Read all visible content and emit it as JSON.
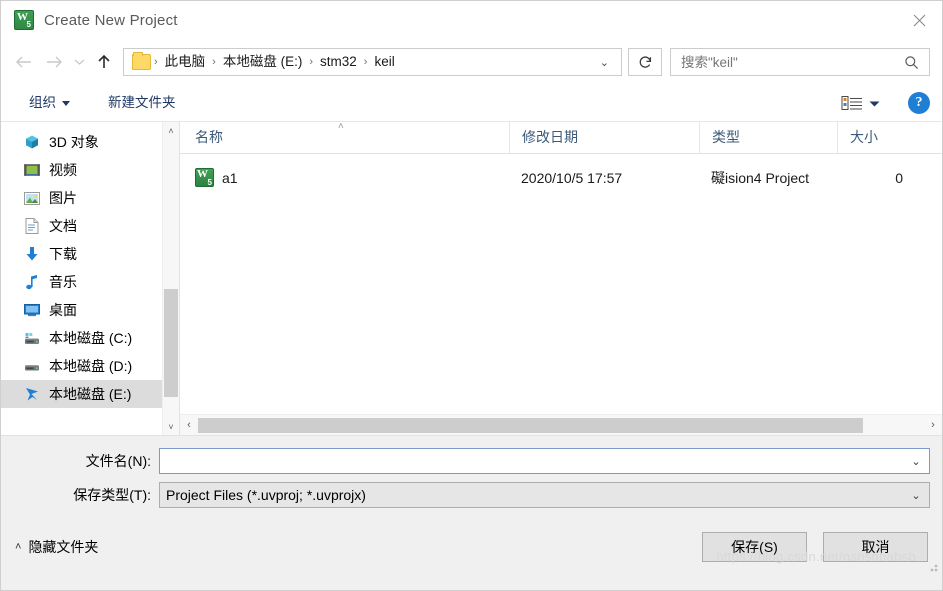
{
  "window": {
    "title": "Create New Project",
    "icon": "uvision-icon",
    "close_label": "✕"
  },
  "nav": {
    "back_icon": "arrow-left-icon",
    "forward_icon": "arrow-right-icon",
    "history_icon": "chevron-down-icon",
    "up_icon": "arrow-up-icon",
    "refresh_icon": "refresh-icon",
    "address_caret": "⌄",
    "breadcrumbs": [
      "此电脑",
      "本地磁盘 (E:)",
      "stm32",
      "keil"
    ],
    "separator": "›"
  },
  "search": {
    "placeholder": "搜索\"keil\"",
    "value": "",
    "icon": "search-icon"
  },
  "commandbar": {
    "organize_label": "组织",
    "new_folder_label": "新建文件夹",
    "view_icon": "view-mode-icon",
    "view_caret": "▼",
    "help_label": "?"
  },
  "sidebar": {
    "items": [
      {
        "label": "3D 对象",
        "icon": "3d-objects-icon",
        "selected": false
      },
      {
        "label": "视频",
        "icon": "videos-icon",
        "selected": false
      },
      {
        "label": "图片",
        "icon": "pictures-icon",
        "selected": false
      },
      {
        "label": "文档",
        "icon": "documents-icon",
        "selected": false
      },
      {
        "label": "下载",
        "icon": "downloads-icon",
        "selected": false
      },
      {
        "label": "音乐",
        "icon": "music-icon",
        "selected": false
      },
      {
        "label": "桌面",
        "icon": "desktop-icon",
        "selected": false
      },
      {
        "label": "本地磁盘 (C:)",
        "icon": "system-drive-icon",
        "selected": false
      },
      {
        "label": "本地磁盘 (D:)",
        "icon": "drive-icon",
        "selected": false
      },
      {
        "label": "本地磁盘 (E:)",
        "icon": "drive-shortcut-icon",
        "selected": true
      }
    ],
    "scroll_up": "˄",
    "scroll_down": "˅"
  },
  "filelist": {
    "columns": [
      {
        "label": "名称",
        "sorted": true,
        "sort_caret": "˄"
      },
      {
        "label": "修改日期",
        "sorted": false
      },
      {
        "label": "类型",
        "sorted": false
      },
      {
        "label": "大小",
        "sorted": false
      }
    ],
    "rows": [
      {
        "name": "a1",
        "icon": "uvision-project-icon",
        "date": "2020/10/5 17:57",
        "type": "礙ision4 Project",
        "size": "0"
      }
    ],
    "hscroll_left": "‹",
    "hscroll_right": "›"
  },
  "form": {
    "filename_label": "文件名(N):",
    "filename_value": "",
    "filename_placeholder": "",
    "filetype_label": "保存类型(T):",
    "filetype_value": "Project Files (*.uvproj; *.uvprojx)",
    "caret": "⌄"
  },
  "footer": {
    "hide_folders_label": "隐藏文件夹",
    "hide_folders_caret": "˄",
    "save_label": "保存(S)",
    "cancel_label": "取消",
    "watermark": "https://blog.csdn.net/nsnsnbabsb"
  },
  "colors": {
    "accent": "#1e7fd4",
    "command_text": "#1f3864",
    "column_header": "#3c5a78",
    "selection": "#dcdcdc",
    "uvision_green": "#2d8240"
  }
}
